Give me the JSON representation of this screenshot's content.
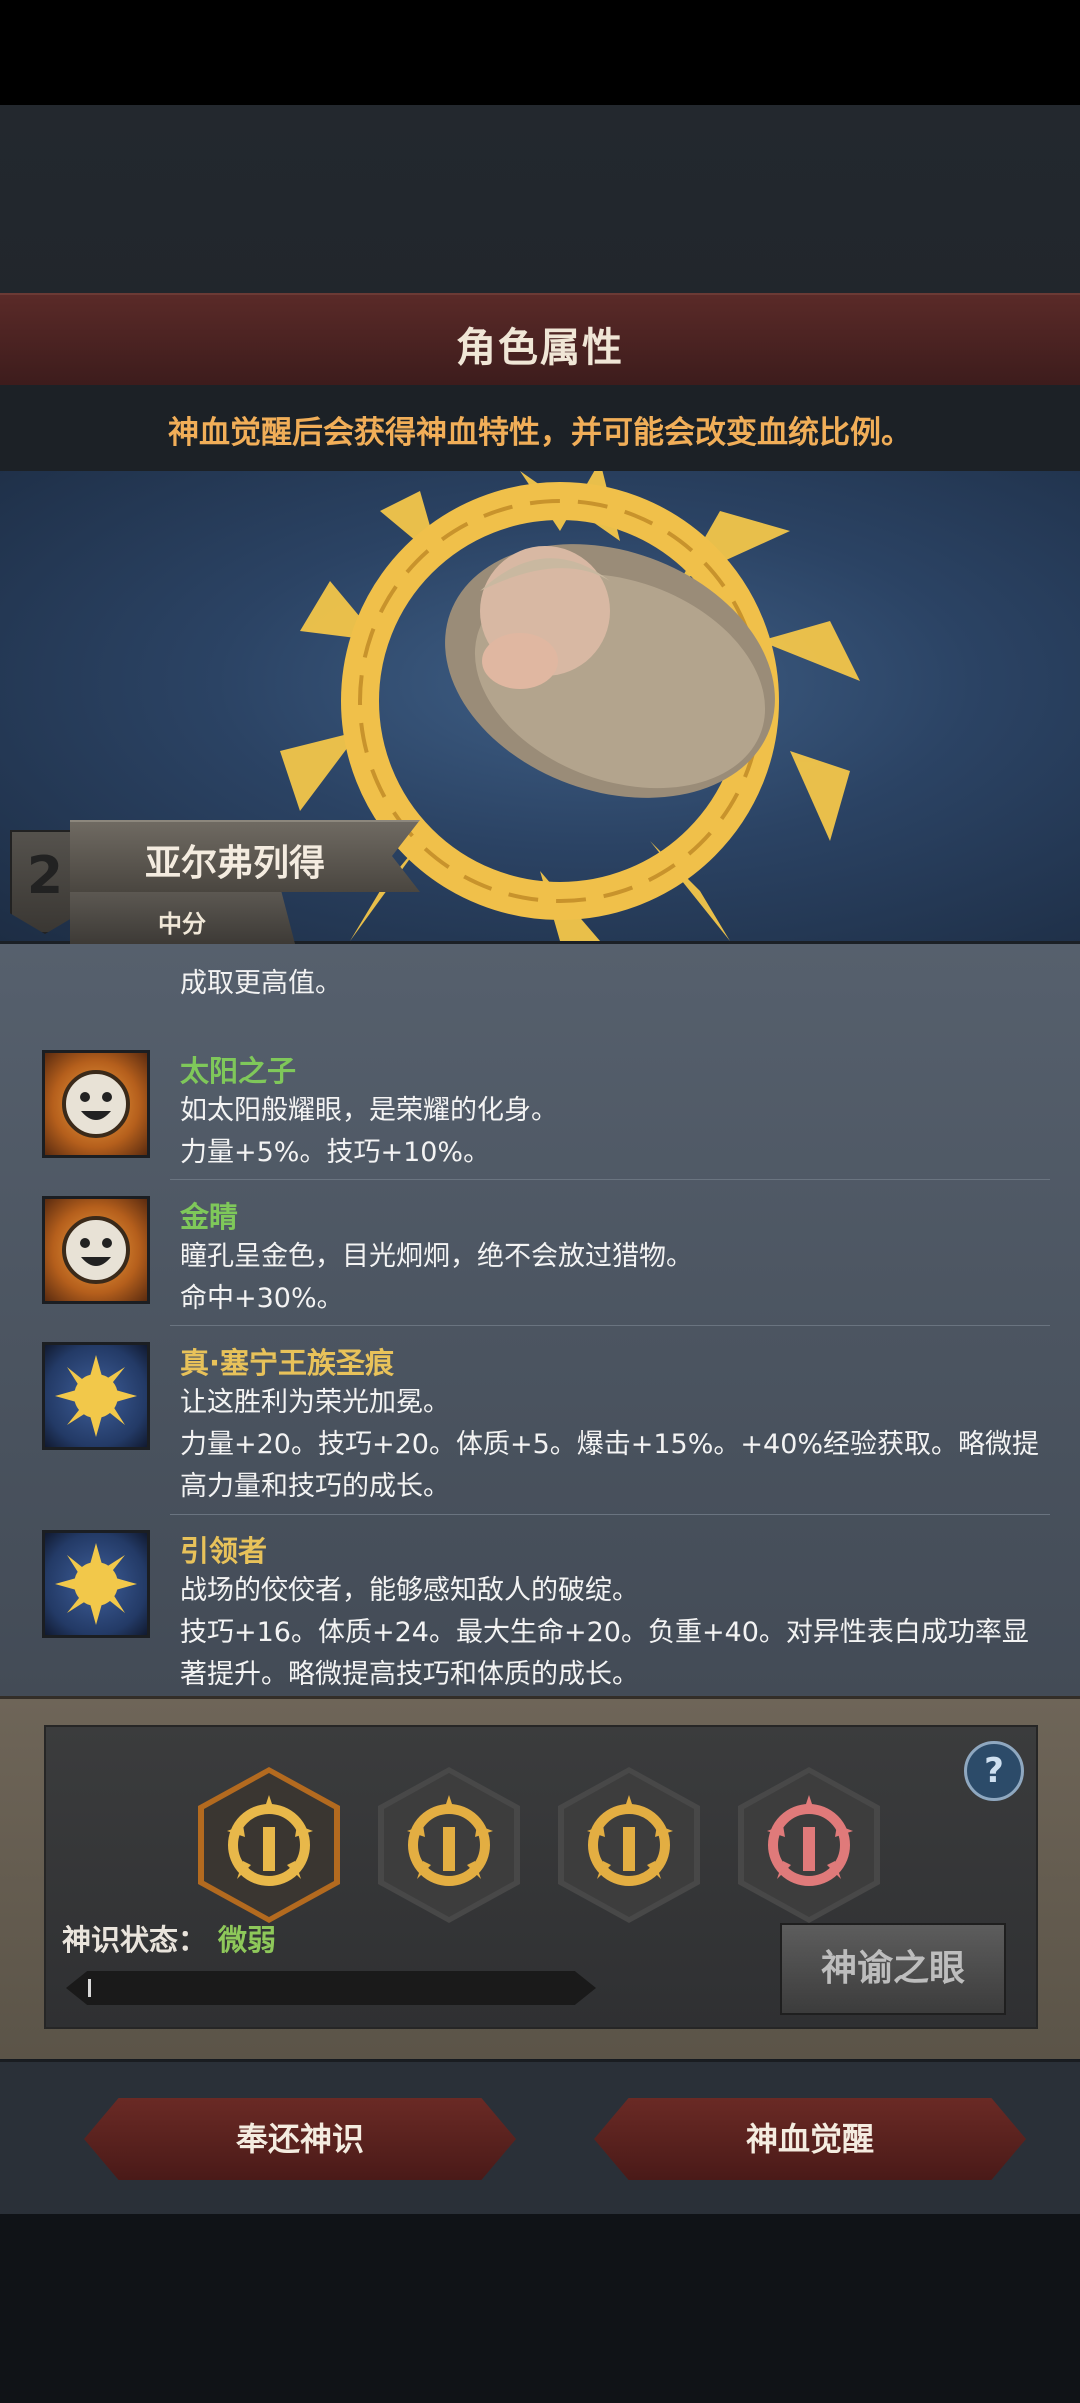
{
  "header": {
    "title": "角色属性",
    "subtitle": "神血觉醒后会获得神血特性，并可能会改变血统比例。"
  },
  "character": {
    "name": "亚尔弗列得",
    "grade": "中分",
    "rank": "2"
  },
  "traits_intro_cut": "成取更高值。",
  "traits": [
    {
      "name": "太阳之子",
      "name_color": "#7fc85a",
      "icon": "smiley-face-icon",
      "lines": [
        "如太阳般耀眼，是荣耀的化身。",
        "力量+5%。技巧+10%。"
      ]
    },
    {
      "name": "金睛",
      "name_color": "#7fc85a",
      "icon": "smiley-face-icon",
      "lines": [
        "瞳孔呈金色，目光炯炯，绝不会放过猎物。",
        "命中+30%。"
      ]
    },
    {
      "name": "真·塞宁王族圣痕",
      "name_color": "#e8c25a",
      "icon": "sun-sigil-icon",
      "lines": [
        "让这胜利为荣光加冕。",
        "力量+20。技巧+20。体质+5。爆击+15%。+40%经验获取。略微提高力量和技巧的成长。"
      ]
    },
    {
      "name": "引领者",
      "name_color": "#e8c25a",
      "icon": "sun-sigil-icon",
      "lines": [
        "战场的佼佼者，能够感知敌人的破绽。",
        "技巧+16。体质+24。最大生命+20。负重+40。对异性表白成功率显著提升。略微提高技巧和体质的成长。"
      ]
    }
  ],
  "divine_slots": [
    {
      "icon": "gold-thorn-ring-icon",
      "state": "active",
      "color": "#e8b84a"
    },
    {
      "icon": "gold-thorn-ring-icon",
      "state": "inactive",
      "color": "#e3ae42"
    },
    {
      "icon": "gold-thorn-ring-icon",
      "state": "inactive",
      "color": "#e3ae42"
    },
    {
      "icon": "red-thorn-ring-icon",
      "state": "inactive",
      "color": "#e07a7a"
    }
  ],
  "status": {
    "label": "神识状态：",
    "value": "微弱",
    "progress": 0.005
  },
  "buttons": {
    "oracle_eye": "神谕之眼",
    "return": "奉还神识",
    "awaken": "神血觉醒",
    "help": "?"
  }
}
